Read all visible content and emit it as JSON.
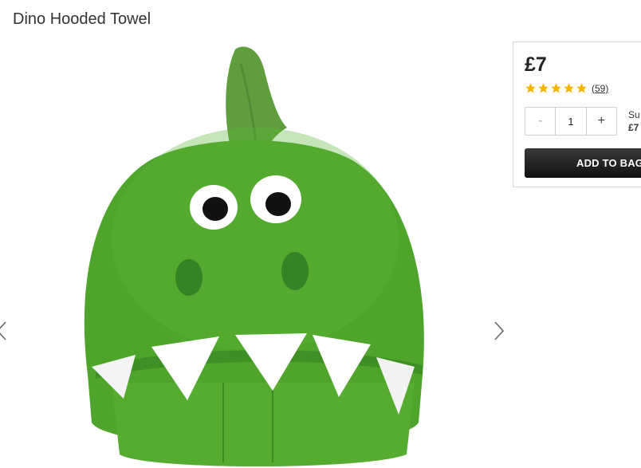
{
  "product": {
    "title": "Dino Hooded Towel",
    "price": "£7",
    "rating": 5,
    "review_count": "(59)"
  },
  "quantity": {
    "decrement_label": "-",
    "value": "1",
    "increment_label": "+"
  },
  "subtotal": {
    "label": "Su",
    "amount": "£7"
  },
  "actions": {
    "add_to_bag_label": "ADD TO BAG"
  },
  "colors": {
    "towel_green": "#4fa52c",
    "star_gold": "#f6b600",
    "button_dark": "#1c1c1c"
  },
  "icons": {
    "prev": "chevron-left-icon",
    "next": "chevron-right-icon",
    "rating": "star-icon"
  }
}
